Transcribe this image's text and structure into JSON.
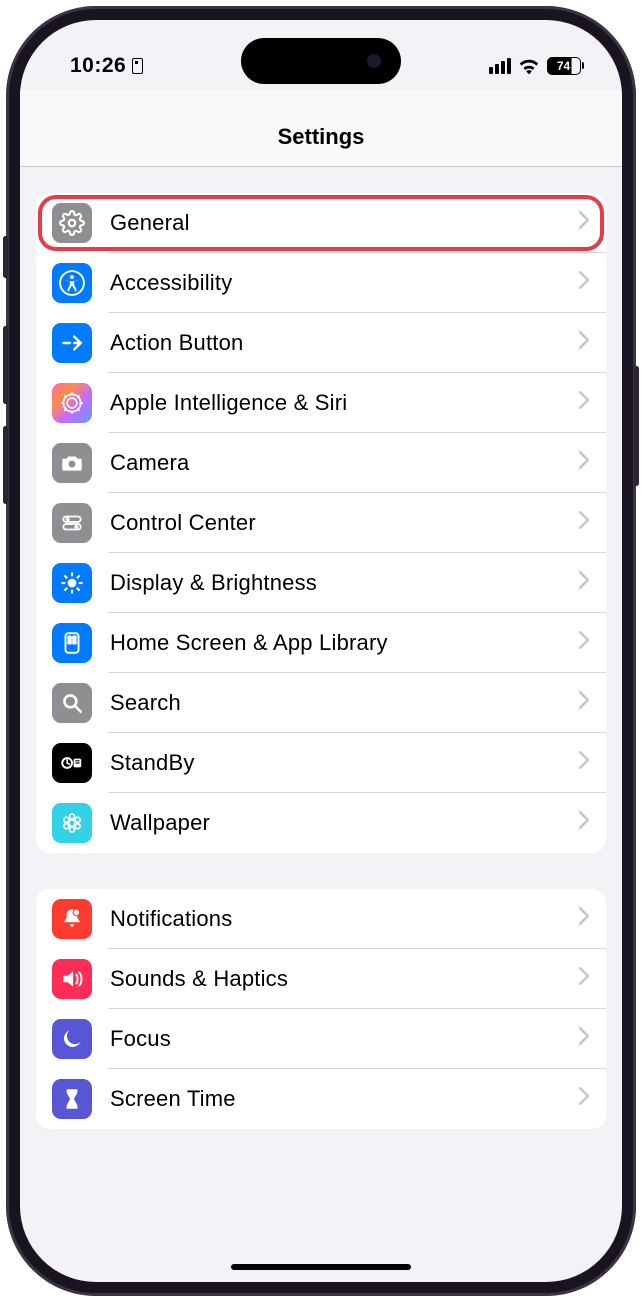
{
  "status": {
    "time": "10:26",
    "battery_pct": "74"
  },
  "header": {
    "title": "Settings"
  },
  "groups": [
    {
      "items": [
        {
          "label": "General"
        },
        {
          "label": "Accessibility"
        },
        {
          "label": "Action Button"
        },
        {
          "label": "Apple Intelligence & Siri"
        },
        {
          "label": "Camera"
        },
        {
          "label": "Control Center"
        },
        {
          "label": "Display & Brightness"
        },
        {
          "label": "Home Screen & App Library"
        },
        {
          "label": "Search"
        },
        {
          "label": "StandBy"
        },
        {
          "label": "Wallpaper"
        }
      ]
    },
    {
      "items": [
        {
          "label": "Notifications"
        },
        {
          "label": "Sounds & Haptics"
        },
        {
          "label": "Focus"
        },
        {
          "label": "Screen Time"
        }
      ]
    }
  ],
  "highlight_row": "General"
}
